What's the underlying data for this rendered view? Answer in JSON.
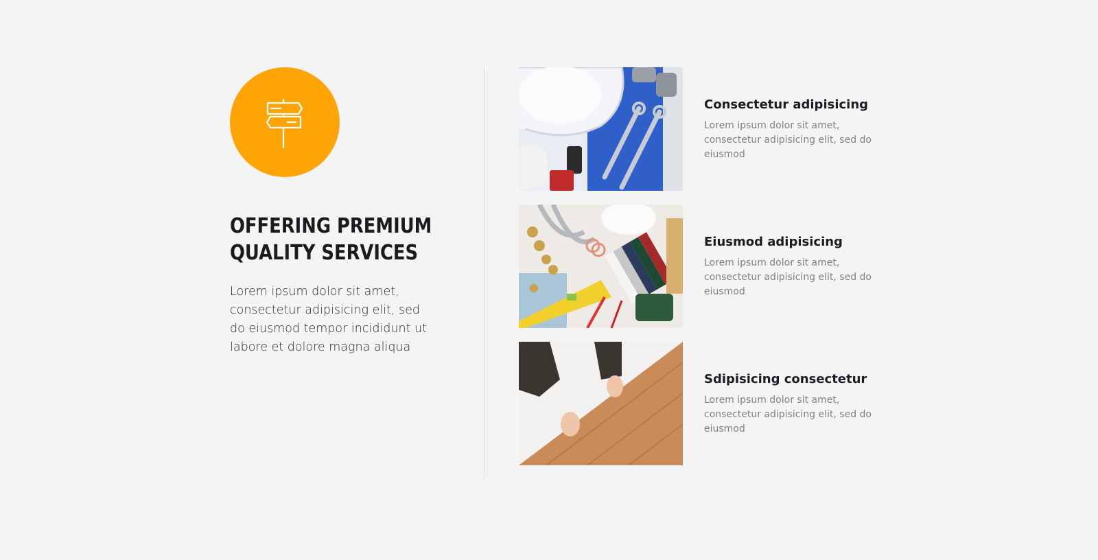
{
  "section": {
    "icon": "signpost-icon",
    "accent_color": "#ffa406",
    "heading_line1": "OFFERING PREMIUM",
    "heading_line2": "QUALITY SERVICES",
    "intro_text": "Lorem ipsum dolor sit amet, consectetur adipisicing elit, sed do eiusmod tempor incididunt ut labore et dolore magna aliqua"
  },
  "services": [
    {
      "image": "hard-hat-tools-photo",
      "title": "Consectetur adipisicing",
      "description": "Lorem ipsum dolor sit amet, consectetur adipisicing elit, sed do eiusmod"
    },
    {
      "image": "plumbing-supplies-photo",
      "title": "Eiusmod adipisicing",
      "description": "Lorem ipsum dolor sit amet, consectetur adipisicing elit, sed do eiusmod"
    },
    {
      "image": "floor-installation-photo",
      "title": "Sdipisicing consectetur",
      "description": "Lorem ipsum dolor sit amet, consectetur adipisicing elit, sed do eiusmod"
    }
  ]
}
